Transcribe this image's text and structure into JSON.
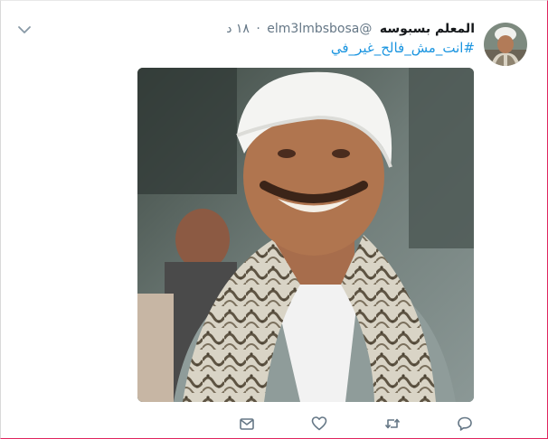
{
  "tweet": {
    "display_name": "المعلم بسبوسه",
    "handle": "@elm3lmbsbosa",
    "separator": "·",
    "time": "١٨ د",
    "text": "#انت_مش_فالح_غير_في"
  },
  "icons": {
    "caret": "chevron-down-icon",
    "reply": "reply-icon",
    "retweet": "retweet-icon",
    "like": "heart-icon",
    "message": "envelope-icon"
  },
  "colors": {
    "link": "#1b95e0",
    "name": "#14171a",
    "meta": "#657786",
    "icon": "#657786"
  }
}
